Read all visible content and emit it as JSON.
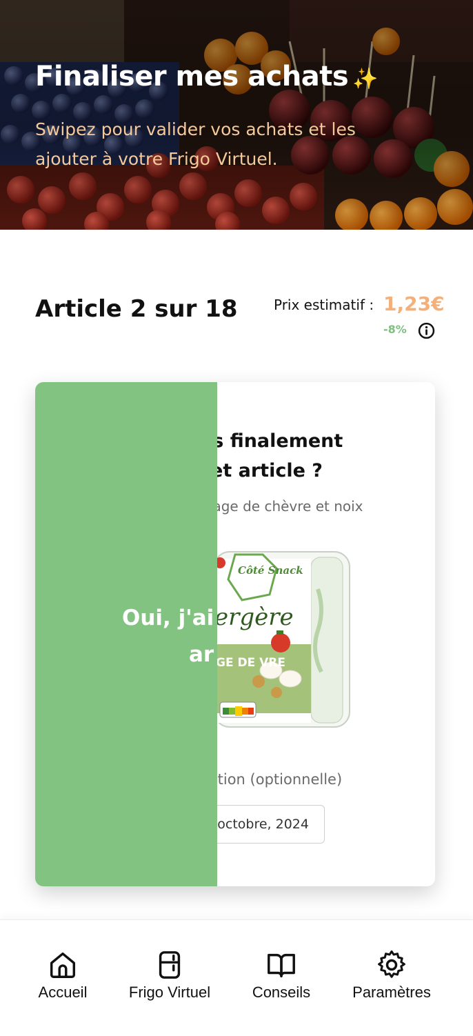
{
  "header": {
    "title": "Finaliser mes achats",
    "title_emoji": "✨",
    "subtitle": "Swipez pour valider vos achats et les ajouter à votre Frigo Virtuel."
  },
  "article": {
    "counter": "Article 2 sur 18",
    "price_label": "Prix estimatif :",
    "price_value": "1,23€",
    "discount": "-8%",
    "info_icon": "info-icon"
  },
  "card": {
    "question_line1": "us finalement",
    "question_line2": "cet article ?",
    "product_desc": "mage de chèvre et noix",
    "date_label": "nption (optionnelle)",
    "date_value": "octobre, 2024",
    "swipe_line1": "Oui, j'ai",
    "swipe_line2": "ar",
    "swipe_color": "#83c382",
    "product_brand": "Côté Snack",
    "product_name_partial": "ergère",
    "product_type_partial": "GE DE VRE"
  },
  "nav": {
    "items": [
      {
        "label": "Accueil",
        "icon": "home-icon"
      },
      {
        "label": "Frigo Virtuel",
        "icon": "fridge-icon"
      },
      {
        "label": "Conseils",
        "icon": "book-icon"
      },
      {
        "label": "Paramètres",
        "icon": "gear-icon"
      }
    ]
  },
  "colors": {
    "accent_orange": "#f3b07a",
    "subtitle_peach": "#f6c99a",
    "success_green": "#7fbf80"
  }
}
